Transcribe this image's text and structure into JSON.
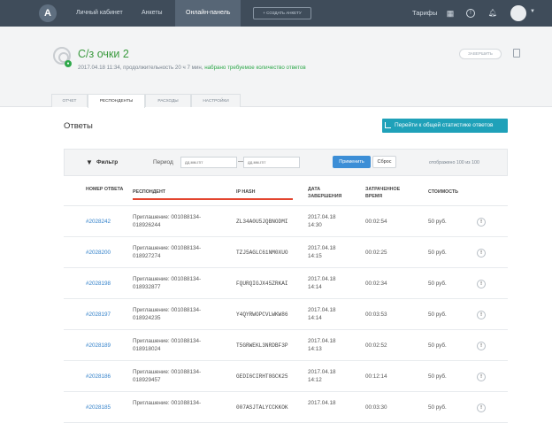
{
  "nav": {
    "items": [
      {
        "label": "Личный кабинет",
        "active": false
      },
      {
        "label": "Анкеты",
        "active": false
      },
      {
        "label": "Онлайн-панель",
        "active": true
      }
    ],
    "create_button": "+ СОЗДАТЬ АНКЕТУ",
    "tariffs": "Тарифы",
    "icons": [
      "apps-grid-icon",
      "help-icon",
      "bell-icon",
      "user-avatar-icon"
    ]
  },
  "survey": {
    "title": "С/з очки 2",
    "meta": "2017.04.18 11:34, продолжительность 20 ч 7 мин, ",
    "meta_status": "набрано требуемое количество ответов",
    "finish_button": "ЗАВЕРШИТЬ",
    "status_color": "#2ea84a"
  },
  "tabs": [
    {
      "label": "ОТЧЕТ",
      "active": false
    },
    {
      "label": "РЕСПОНДЕНТЫ",
      "active": true
    },
    {
      "label": "РАСХОДЫ",
      "active": false
    },
    {
      "label": "НАСТРОЙКИ",
      "active": false
    }
  ],
  "answers": {
    "title": "Ответы",
    "stats_button": "Перейти к общей статистике ответов",
    "filter": {
      "label": "Фильтр",
      "period_label": "Период",
      "date_from_placeholder": "дд.мм.гггг",
      "date_to_placeholder": "дд.мм.гггг",
      "dash": "—",
      "apply": "Применить",
      "reset": "Сброс",
      "shown": "отображено 100 из 100"
    },
    "columns": {
      "number": "НОМЕР ОТВЕТА",
      "respondent": "РЕСПОНДЕНТ",
      "ip": "IP HASH",
      "date": "ДАТА ЗАВЕРШЕНИЯ",
      "time": "ЗАТРАЧЕННОЕ ВРЕМЯ",
      "cost": "СТОИМОСТЬ"
    },
    "rows": [
      {
        "id": "#2028242",
        "resp1": "Приглашение: 001088134-",
        "resp2": "018926244",
        "ip": "ZL34A0U5JQBNODMI",
        "date": "2017.04.18",
        "time_of_day": "14:30",
        "duration": "00:02:54",
        "cost": "50 руб."
      },
      {
        "id": "#2028200",
        "resp1": "Приглашение: 001088134-",
        "resp2": "018927274",
        "ip": "TZJ5AGLC61NM0XUO",
        "date": "2017.04.18",
        "time_of_day": "14:15",
        "duration": "00:02:25",
        "cost": "50 руб."
      },
      {
        "id": "#2028198",
        "resp1": "Приглашение: 001088134-",
        "resp2": "018932877",
        "ip": "FQURQIGJX45ZRKAI",
        "date": "2017.04.18",
        "time_of_day": "14:14",
        "duration": "00:02:34",
        "cost": "50 руб."
      },
      {
        "id": "#2028197",
        "resp1": "Приглашение: 001088134-",
        "resp2": "018924235",
        "ip": "Y4QYRWOPCVLWKW86",
        "date": "2017.04.18",
        "time_of_day": "14:14",
        "duration": "00:03:53",
        "cost": "50 руб."
      },
      {
        "id": "#2028189",
        "resp1": "Приглашение: 001088134-",
        "resp2": "018918024",
        "ip": "T5GRWEKL3NRDBF3P",
        "date": "2017.04.18",
        "time_of_day": "14:13",
        "duration": "00:02:52",
        "cost": "50 руб."
      },
      {
        "id": "#2028186",
        "resp1": "Приглашение: 001088134-",
        "resp2": "018929457",
        "ip": "GEDI6CIRHT8GCK25",
        "date": "2017.04.18",
        "time_of_day": "14:12",
        "duration": "00:12:14",
        "cost": "50 руб."
      },
      {
        "id": "#2028185",
        "resp1": "Приглашение: 001088134-",
        "resp2": "",
        "ip": "007ASJTALYCCKKOK",
        "date": "2017.04.18",
        "time_of_day": "",
        "duration": "00:03:30",
        "cost": "50 руб."
      }
    ]
  }
}
